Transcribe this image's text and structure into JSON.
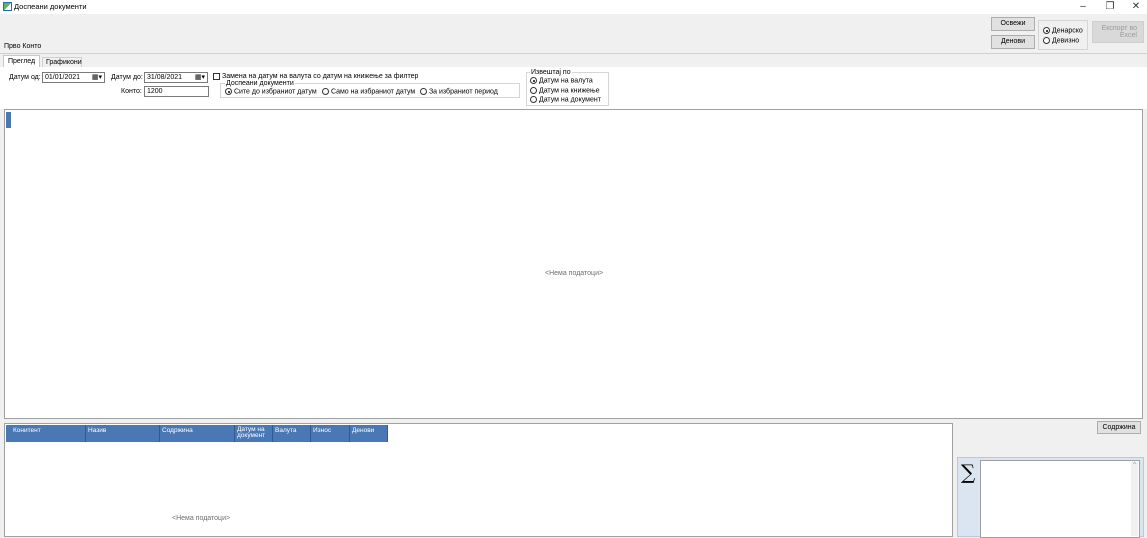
{
  "window": {
    "title": "Доспеани документи",
    "minimize": "–",
    "restore": "❐",
    "close": "✕"
  },
  "toolbar": {
    "refresh_label": "Освежи",
    "days_label": "Денови",
    "currency_options": [
      "Денарско",
      "Девизно"
    ],
    "export_label": "Експорт во Excel"
  },
  "section_label": "Прво Конто",
  "tabs": [
    "Преглед",
    "Графикони"
  ],
  "filters": {
    "date_from_label": "Датум од:",
    "date_from_value": "01/01/2021",
    "date_to_label": "Датум до:",
    "date_to_value": "31/08/2021",
    "konto_label": "Конто:",
    "konto_value": "1200",
    "replace_checkbox_label": "Замена на датум на валута со датум на книжење за филтер",
    "overdue_group_label": "Доспеани документи",
    "overdue_options": [
      "Сите до избраниот датум",
      "Само на избраниот датум",
      "За избраниот период"
    ],
    "report_group_label": "Извештај по",
    "report_options": [
      "Датум на валута",
      "Датум на книжење",
      "Датум на документ"
    ]
  },
  "main_panel": {
    "empty_text": "<Нема податоци>"
  },
  "detail_grid": {
    "columns": [
      "Конитент",
      "Назив",
      "Содржина",
      "Датум на документ",
      "Валута",
      "Износ",
      "Денови"
    ],
    "empty_text": "<Нема податоци>"
  },
  "side": {
    "content_button": "Содржина",
    "sigma": "∑"
  },
  "colors": {
    "grid_header": "#4a78b5"
  }
}
